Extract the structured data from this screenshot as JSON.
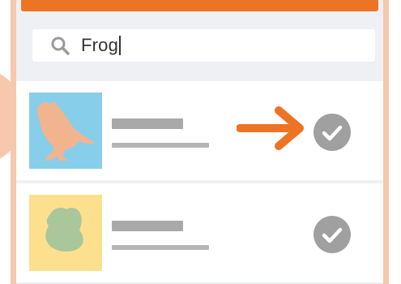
{
  "search": {
    "icon": "search-icon",
    "value": "Frog"
  },
  "results": [
    {
      "thumbnail_icon": "bird-silhouette-icon",
      "thumbnail_bg": "#87ceeb",
      "thumbnail_shape_color": "#f2b48e",
      "status_icon": "check-circle-icon",
      "highlight_icon": "arrow-right-icon"
    },
    {
      "thumbnail_icon": "frog-silhouette-icon",
      "thumbnail_bg": "#fde08d",
      "thumbnail_shape_color": "#a9c79a",
      "status_icon": "check-circle-icon"
    }
  ],
  "colors": {
    "accent": "#ec7424",
    "frame": "#f7c8ad",
    "check": "#a0a0a0"
  }
}
